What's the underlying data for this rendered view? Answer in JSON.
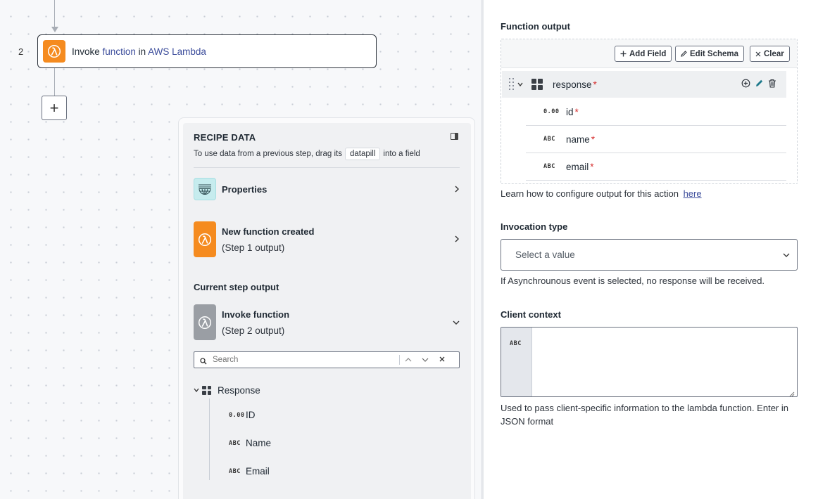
{
  "canvas": {
    "step_number": "2",
    "step": {
      "prefix": "Invoke",
      "function_word": "function",
      "connector_word": "in",
      "app_name": "AWS Lambda"
    },
    "add_step_label": "+"
  },
  "recipe_data": {
    "title": "RECIPE DATA",
    "hint_before": "To use data from a previous step, drag its",
    "pill": "datapill",
    "hint_after": "into a field",
    "sources": [
      {
        "label": "Properties",
        "icon": "globe-list-icon"
      },
      {
        "label": "New function created",
        "sub": "(Step 1 output)",
        "icon": "lambda-icon"
      }
    ],
    "current_step_label": "Current step output",
    "current_step": {
      "label": "Invoke function",
      "sub": "(Step 2 output)",
      "icon": "lambda-icon"
    },
    "search_placeholder": "Search",
    "tree": {
      "root": "Response",
      "children": [
        {
          "type": "0.00",
          "label": "ID"
        },
        {
          "type": "ABC",
          "label": "Name"
        },
        {
          "type": "ABC",
          "label": "Email"
        }
      ]
    }
  },
  "form": {
    "function_output": {
      "label": "Function output",
      "buttons": {
        "add_field": "Add Field",
        "edit_schema": "Edit Schema",
        "clear": "Clear"
      },
      "root_field": "response",
      "fields": [
        {
          "type": "0.00",
          "name": "id"
        },
        {
          "type": "ABC",
          "name": "name"
        },
        {
          "type": "ABC",
          "name": "email"
        }
      ],
      "help_text": "Learn how to configure output for this action",
      "help_link": "here"
    },
    "invocation_type": {
      "label": "Invocation type",
      "placeholder": "Select a value",
      "help_text": "If Asynchrounous event is selected, no response will be received."
    },
    "client_context": {
      "label": "Client context",
      "type_tag": "ABC",
      "value": "",
      "help_text": "Used to pass client-specific information to the lambda function. Enter in JSON format"
    }
  },
  "colors": {
    "lambda_orange": "#f58b1f",
    "link_blue": "#3b4c9b",
    "required_red": "#d62e2e"
  }
}
